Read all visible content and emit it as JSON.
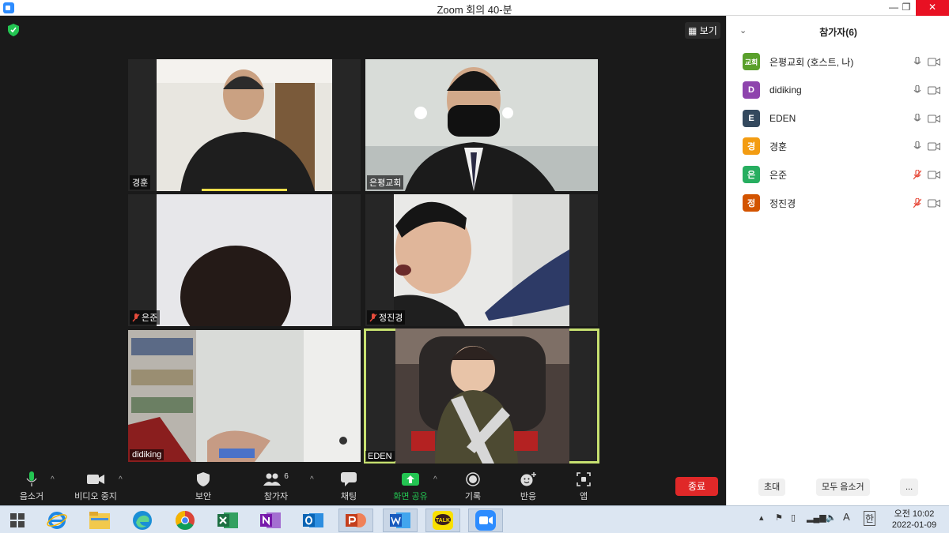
{
  "window": {
    "title": "Zoom 회의 40-분"
  },
  "main": {
    "view_label": "보기",
    "tiles": [
      {
        "name": "경훈",
        "muted": false
      },
      {
        "name": "은평교회",
        "muted": false
      },
      {
        "name": "은준",
        "muted": true
      },
      {
        "name": "정진경",
        "muted": true
      },
      {
        "name": "didiking",
        "muted": false
      },
      {
        "name": "EDEN",
        "muted": false
      }
    ]
  },
  "toolbar": {
    "mute_label": "음소거",
    "video_label": "비디오 중지",
    "security_label": "보안",
    "participants_label": "참가자",
    "participants_count": "6",
    "chat_label": "채팅",
    "share_label": "화면 공유",
    "record_label": "기록",
    "reactions_label": "반응",
    "apps_label": "앱",
    "end_label": "종료"
  },
  "panel": {
    "title": "참가자(6)",
    "participants": [
      {
        "initial": "교회",
        "name": "은평교회 (호스트, 나)",
        "color": "#5aa02c",
        "muted": false
      },
      {
        "initial": "D",
        "name": "didiking",
        "color": "#8e44ad",
        "muted": false
      },
      {
        "initial": "E",
        "name": "EDEN",
        "color": "#34495e",
        "muted": false
      },
      {
        "initial": "경",
        "name": "경훈",
        "color": "#f39c12",
        "muted": false
      },
      {
        "initial": "은",
        "name": "은준",
        "color": "#27ae60",
        "muted": true
      },
      {
        "initial": "정",
        "name": "정진경",
        "color": "#d35400",
        "muted": true
      }
    ],
    "invite_label": "초대",
    "mute_all_label": "모두 음소거",
    "more_label": "..."
  },
  "taskbar": {
    "clock_time": "오전 10:02",
    "clock_date": "2022-01-09",
    "ime_label": "A",
    "lang_label": "한"
  }
}
